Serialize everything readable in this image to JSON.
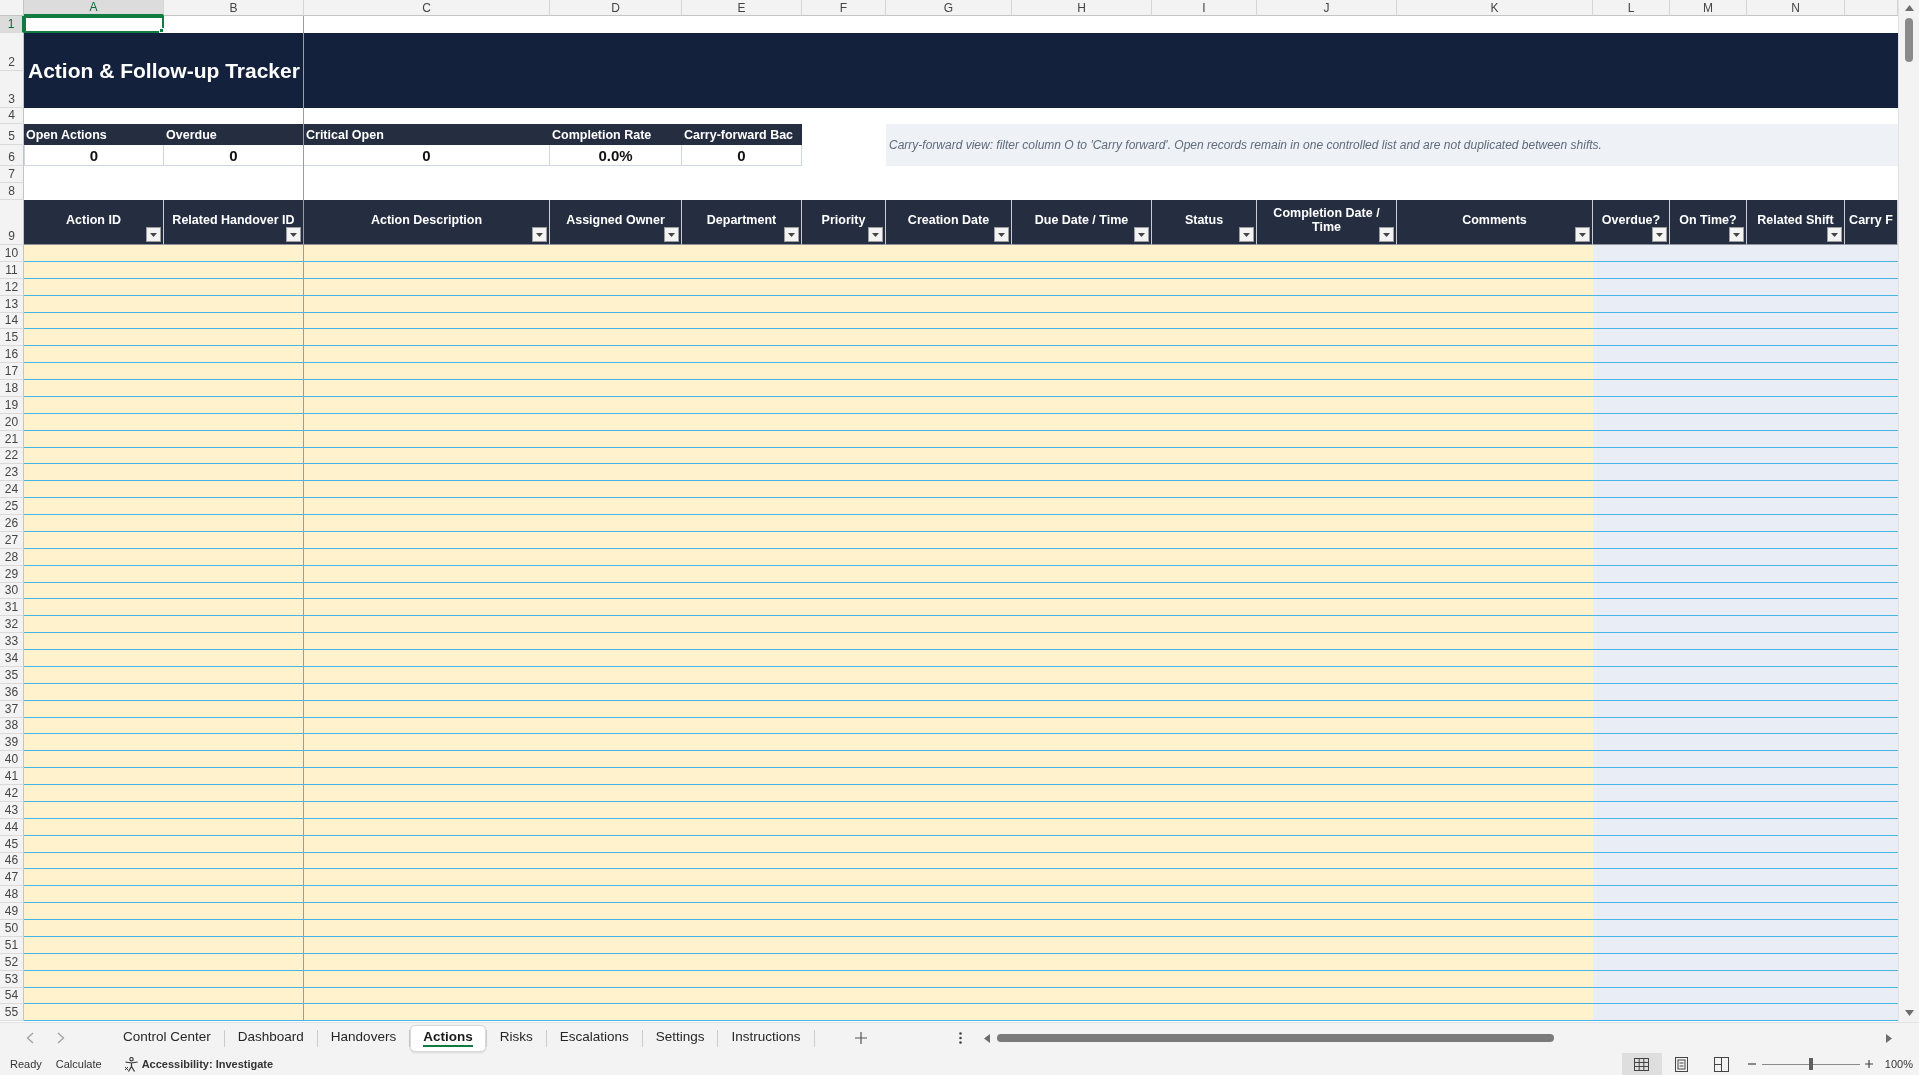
{
  "column_headers": [
    {
      "label": "A",
      "selected": true
    },
    {
      "label": "B",
      "selected": false
    },
    {
      "label": "C",
      "selected": false
    },
    {
      "label": "D",
      "selected": false
    },
    {
      "label": "E",
      "selected": false
    },
    {
      "label": "F",
      "selected": false
    },
    {
      "label": "G",
      "selected": false
    },
    {
      "label": "H",
      "selected": false
    },
    {
      "label": "I",
      "selected": false
    },
    {
      "label": "J",
      "selected": false
    },
    {
      "label": "K",
      "selected": false
    },
    {
      "label": "L",
      "selected": false
    },
    {
      "label": "M",
      "selected": false
    },
    {
      "label": "N",
      "selected": false
    }
  ],
  "row_headers": [
    {
      "label": "1",
      "selected": true
    },
    {
      "label": "2",
      "selected": false
    },
    {
      "label": "3",
      "selected": false
    },
    {
      "label": "4",
      "selected": false
    },
    {
      "label": "5",
      "selected": false
    },
    {
      "label": "6",
      "selected": false
    },
    {
      "label": "7",
      "selected": false
    },
    {
      "label": "8",
      "selected": false
    },
    {
      "label": "9",
      "selected": false
    },
    {
      "label": "10",
      "selected": false
    },
    {
      "label": "11",
      "selected": false
    },
    {
      "label": "12",
      "selected": false
    },
    {
      "label": "13",
      "selected": false
    },
    {
      "label": "14",
      "selected": false
    },
    {
      "label": "15",
      "selected": false
    },
    {
      "label": "16",
      "selected": false
    },
    {
      "label": "17",
      "selected": false
    },
    {
      "label": "18",
      "selected": false
    },
    {
      "label": "19",
      "selected": false
    },
    {
      "label": "20",
      "selected": false
    },
    {
      "label": "21",
      "selected": false
    },
    {
      "label": "22",
      "selected": false
    },
    {
      "label": "23",
      "selected": false
    },
    {
      "label": "24",
      "selected": false
    },
    {
      "label": "25",
      "selected": false
    },
    {
      "label": "26",
      "selected": false
    },
    {
      "label": "27",
      "selected": false
    },
    {
      "label": "28",
      "selected": false
    },
    {
      "label": "29",
      "selected": false
    },
    {
      "label": "30",
      "selected": false
    },
    {
      "label": "31",
      "selected": false
    },
    {
      "label": "32",
      "selected": false
    },
    {
      "label": "33",
      "selected": false
    },
    {
      "label": "34",
      "selected": false
    },
    {
      "label": "35",
      "selected": false
    },
    {
      "label": "36",
      "selected": false
    },
    {
      "label": "37",
      "selected": false
    },
    {
      "label": "38",
      "selected": false
    },
    {
      "label": "39",
      "selected": false
    },
    {
      "label": "40",
      "selected": false
    },
    {
      "label": "41",
      "selected": false
    },
    {
      "label": "42",
      "selected": false
    },
    {
      "label": "43",
      "selected": false
    },
    {
      "label": "44",
      "selected": false
    },
    {
      "label": "45",
      "selected": false
    },
    {
      "label": "46",
      "selected": false
    },
    {
      "label": "47",
      "selected": false
    },
    {
      "label": "48",
      "selected": false
    },
    {
      "label": "49",
      "selected": false
    },
    {
      "label": "50",
      "selected": false
    },
    {
      "label": "51",
      "selected": false
    },
    {
      "label": "52",
      "selected": false
    },
    {
      "label": "53",
      "selected": false
    },
    {
      "label": "54",
      "selected": false
    },
    {
      "label": "55",
      "selected": false
    }
  ],
  "title": "Action & Follow-up Tracker",
  "kpis": [
    {
      "label": "Open Actions",
      "value": "0"
    },
    {
      "label": "Overdue",
      "value": "0"
    },
    {
      "label": "Critical Open",
      "value": "0"
    },
    {
      "label": "Completion Rate",
      "value": "0.0%"
    },
    {
      "label": "Carry-forward Bac",
      "value": "0"
    }
  ],
  "note": "Carry-forward view: filter column O to 'Carry forward'. Open records remain in one controlled list and are not duplicated between shifts.",
  "table": {
    "columns": [
      {
        "label": "Action ID",
        "kind": "input",
        "filter": true
      },
      {
        "label": "Related Handover ID",
        "kind": "input",
        "filter": true
      },
      {
        "label": "Action Description",
        "kind": "input",
        "filter": true
      },
      {
        "label": "Assigned Owner",
        "kind": "input",
        "filter": true
      },
      {
        "label": "Department",
        "kind": "input",
        "filter": true
      },
      {
        "label": "Priority",
        "kind": "input",
        "filter": true
      },
      {
        "label": "Creation Date",
        "kind": "input",
        "filter": true
      },
      {
        "label": "Due Date / Time",
        "kind": "input",
        "filter": true
      },
      {
        "label": "Status",
        "kind": "input",
        "filter": true
      },
      {
        "label": "Completion Date / Time",
        "kind": "input",
        "filter": true
      },
      {
        "label": "Comments",
        "kind": "input",
        "filter": true
      },
      {
        "label": "Overdue?",
        "kind": "calculated",
        "filter": true
      },
      {
        "label": "On Time?",
        "kind": "calculated",
        "filter": true
      },
      {
        "label": "Related Shift",
        "kind": "calculated",
        "filter": true
      },
      {
        "label": "Carry F",
        "kind": "calculated",
        "filter": false
      }
    ]
  },
  "sheet_tabs": [
    {
      "label": "Control Center",
      "selected": false
    },
    {
      "label": "Dashboard",
      "selected": false
    },
    {
      "label": "Handovers",
      "selected": false
    },
    {
      "label": "Actions",
      "selected": true
    },
    {
      "label": "Risks",
      "selected": false
    },
    {
      "label": "Escalations",
      "selected": false
    },
    {
      "label": "Settings",
      "selected": false
    },
    {
      "label": "Instructions",
      "selected": false
    }
  ],
  "status_bar": {
    "mode": "Ready",
    "calculate": "Calculate",
    "accessibility": "Accessibility: Investigate",
    "views": [
      {
        "kind": "normal",
        "selected": true
      },
      {
        "kind": "page-layout",
        "selected": false
      },
      {
        "kind": "page-break",
        "selected": false
      }
    ],
    "zoom": {
      "level": 0.5,
      "reading": "100%"
    }
  }
}
